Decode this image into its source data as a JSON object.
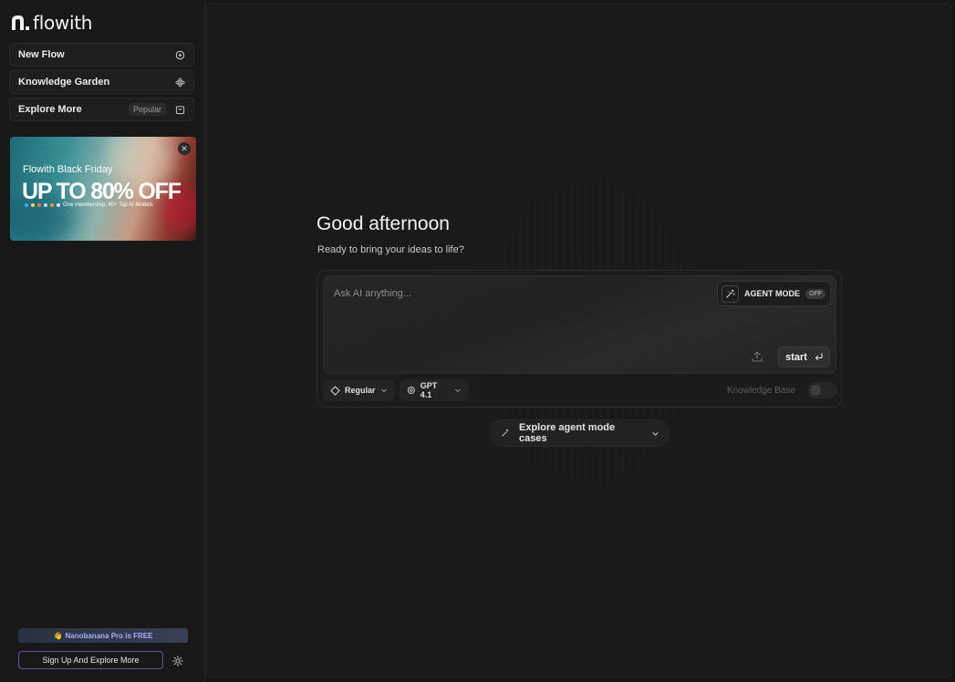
{
  "brand": {
    "name": "flowith"
  },
  "sidebar": {
    "items": [
      {
        "label": "New Flow",
        "icon": "chat-plus-icon"
      },
      {
        "label": "Knowledge Garden",
        "icon": "atom-icon"
      },
      {
        "label": "Explore More",
        "badge": "Popular",
        "icon": "shopping-bag-icon"
      }
    ],
    "promo": {
      "subtitle": "Flowith Black Friday",
      "title": "UP TO 80% OFF",
      "footnote": "One membership, 40+ Top AI Models",
      "close": "✕"
    },
    "nano_banner": "Nanobanana Pro is FREE",
    "signup_label": "Sign Up And Explore More"
  },
  "main": {
    "greeting": "Good afternoon",
    "subgreeting": "Ready to bring your ideas to life?",
    "input_placeholder": "Ask AI anything...",
    "agent_mode": {
      "label": "AGENT MODE",
      "state": "OFF"
    },
    "start_label": "start",
    "mode_label": "Regular",
    "model_label": "GPT 4.1",
    "knowledge_base_label": "Knowledge Base",
    "knowledge_base_enabled": false,
    "explore_cases_label": "Explore agent mode cases"
  },
  "colors": {
    "accent_border": "#6a4c9e",
    "nano_text": "#9fb0ff"
  }
}
